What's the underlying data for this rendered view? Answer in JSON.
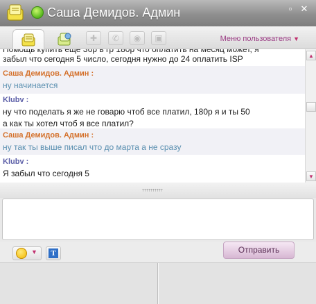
{
  "window": {
    "title": "Саша Демидов. Админ",
    "minimize_label": "▫",
    "close_label": "✕"
  },
  "toolbar": {
    "user_menu_label": "Меню пользователя",
    "user_menu_arrow": "▼",
    "tool_icons": [
      "add-contact-icon",
      "phone-icon",
      "video-icon",
      "photo-icon"
    ]
  },
  "chat": {
    "partial_top_line": "Помощь купить еще 3бр в гр 180р что оплатить на месяц может, я",
    "messages": [
      {
        "sender": "",
        "lines": [
          "забыл что сегодня 5 число, сегодня нужно до 24 оплатить ISP"
        ],
        "is_me": false
      },
      {
        "sender": "Саша Демидов. Админ :",
        "lines": [
          "ну начинается"
        ],
        "is_me": true
      },
      {
        "sender": "Klubv :",
        "lines": [
          "ну что поделать я же не говарю чтоб все платил, 180р я и ты 50",
          "а как ты хотел чтоб я все платил?"
        ],
        "is_me": false
      },
      {
        "sender": "Саша Демидов. Админ :",
        "lines": [
          "ну так ты выше писал что до марта а не сразу"
        ],
        "is_me": true
      },
      {
        "sender": "Klubv :",
        "lines": [
          "Я забыл что сегодня 5"
        ],
        "is_me": false
      }
    ]
  },
  "composer": {
    "input_value": "",
    "send_label": "Отправить"
  },
  "colors": {
    "accent": "#c0306e",
    "admin_name": "#d4702a",
    "other_name": "#5c5fa8",
    "my_text": "#5a8fb0"
  }
}
